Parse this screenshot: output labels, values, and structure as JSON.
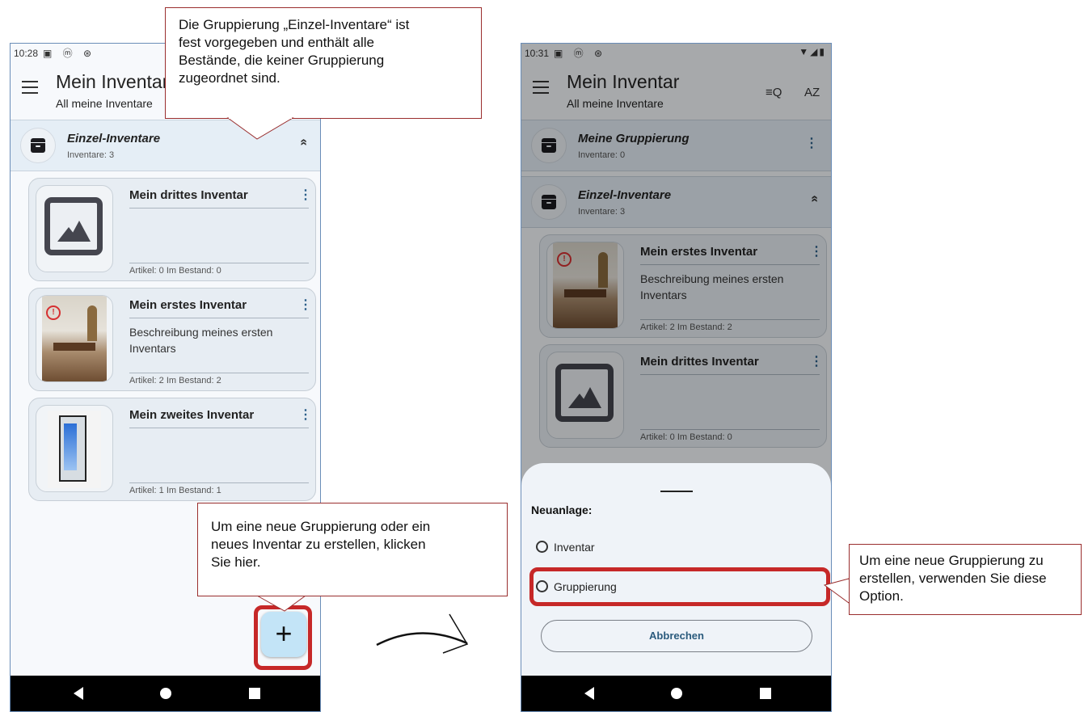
{
  "left_phone": {
    "status_time": "10:28",
    "status_icons": "▣ ⓜ ⊛",
    "app_title": "Mein Inventar",
    "app_subtitle": "All meine Inventare",
    "group": {
      "name": "Einzel-Inventare",
      "count": "Inventare: 3",
      "chevron": "«"
    },
    "cards": [
      {
        "title": "Mein drittes Inventar",
        "description": "",
        "meta": "Artikel: 0   Im Bestand: 0"
      },
      {
        "title": "Mein erstes Inventar",
        "description": "Beschreibung meines ersten Inventars",
        "meta": "Artikel: 2   Im Bestand: 2"
      },
      {
        "title": "Mein zweites Inventar",
        "description": "",
        "meta": "Artikel: 1   Im Bestand: 1"
      }
    ],
    "fab_label": "+"
  },
  "right_phone": {
    "status_time": "10:31",
    "status_icons": "▣ ⓜ ⊛",
    "system_icons": "▼◢▮",
    "app_title": "Mein Inventar",
    "app_subtitle": "All meine Inventare",
    "search_filter_label": "≡Q",
    "sort_label": "AZ",
    "groups": [
      {
        "name": "Meine Gruppierung",
        "count": "Inventare: 0"
      },
      {
        "name": "Einzel-Inventare",
        "count": "Inventare: 3"
      }
    ],
    "cards": [
      {
        "title": "Mein erstes Inventar",
        "description": "Beschreibung meines ersten Inventars",
        "meta": "Artikel: 2   Im Bestand: 2"
      },
      {
        "title": "Mein drittes Inventar",
        "description": "",
        "meta": "Artikel: 0   Im Bestand: 0"
      }
    ],
    "sheet": {
      "heading": "Neuanlage:",
      "options": [
        "Inventar",
        "Gruppierung"
      ],
      "cancel_label": "Abbrechen"
    }
  },
  "callouts": {
    "top": [
      "Die Gruppierung „Einzel-Inventare“ ist",
      "fest vorgegeben und enthält alle",
      "Bestände, die keiner Gruppierung",
      "zugeordnet sind."
    ],
    "bottom": [
      "Um eine neue Gruppierung oder ein",
      "neues Inventar zu erstellen, klicken",
      "Sie hier."
    ],
    "right": [
      "Um eine neue Gruppierung zu",
      "erstellen, verwenden Sie diese",
      "Option."
    ]
  },
  "colors": {
    "highlight": "#c62828",
    "fab": "#c3e4f7",
    "accent_text": "#2b5b7d",
    "warning": "#d63031"
  }
}
